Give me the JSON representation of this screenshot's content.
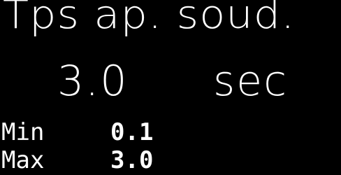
{
  "display": {
    "title": "Tps ap. soud.",
    "value": "3.0",
    "unit": "sec"
  },
  "limits": {
    "min_label": "Min",
    "min_value": "0.1",
    "max_label": "Max",
    "max_value": "3.0"
  },
  "colors": {
    "background": "#000000",
    "foreground": "#ffffff"
  }
}
